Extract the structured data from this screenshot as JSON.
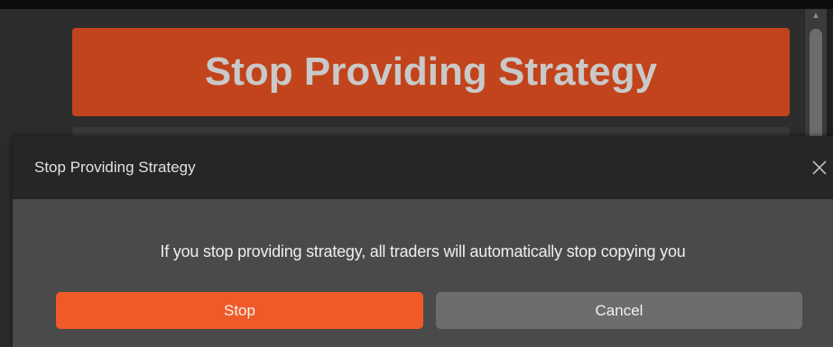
{
  "background": {
    "big_button_label": "Stop Providing Strategy"
  },
  "dialog": {
    "title": "Stop Providing Strategy",
    "close_icon": "close-icon",
    "message": "If you stop providing strategy, all traders will automatically stop copying you",
    "stop_label": "Stop",
    "cancel_label": "Cancel"
  },
  "colors": {
    "accent": "#f05a28",
    "big_button": "#c2441c",
    "cancel": "#6d6d6d",
    "dialog_header": "#262626",
    "dialog_body": "#4a4a4a"
  }
}
